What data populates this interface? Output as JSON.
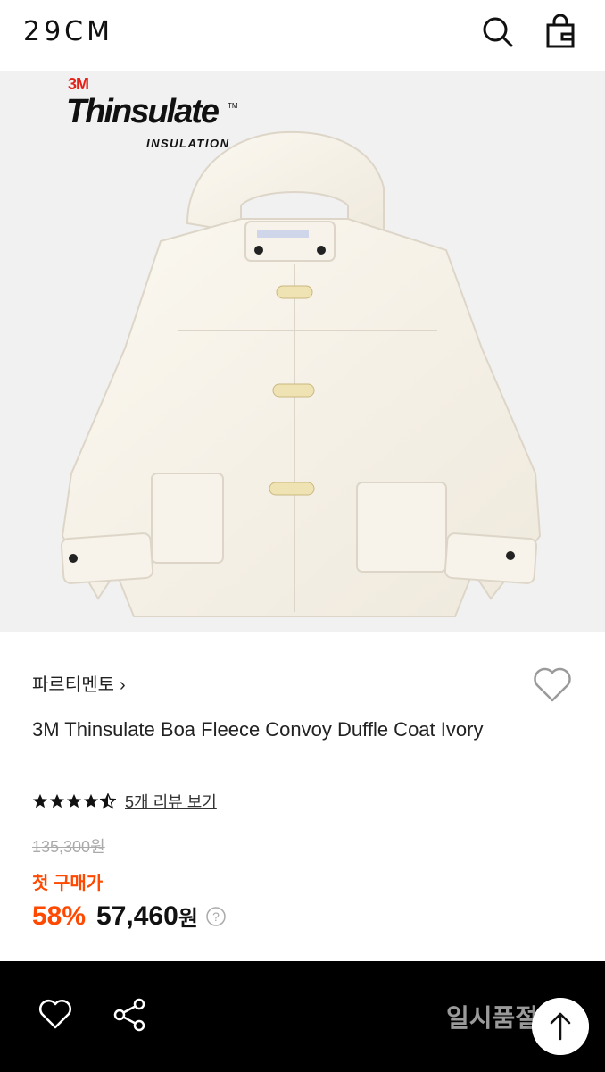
{
  "header": {
    "logo": "29CM",
    "search_icon": "search-icon",
    "bag_icon": "shopping-bag-icon"
  },
  "hero": {
    "badge_brand": "3M",
    "badge_title": "Thinsulate",
    "badge_tm": "TM",
    "badge_sub": "INSULATION"
  },
  "product": {
    "brand": "파르티멘토",
    "title": "3M Thinsulate Boa Fleece Convoy Duffle Coat Ivory",
    "rating_stars": 4.5,
    "review_link": "5개 리뷰 보기",
    "original_price": "135,300원",
    "promo_label": "첫 구매가",
    "discount": "58%",
    "sale_price": "57,460",
    "currency": "원"
  },
  "bottom_bar": {
    "status": "일시품절",
    "wish_icon": "heart-icon",
    "share_icon": "share-icon",
    "top_icon": "arrow-up-icon"
  },
  "colors": {
    "accent": "#ff4800",
    "bar": "#000000",
    "strike": "#aaaaaa"
  }
}
